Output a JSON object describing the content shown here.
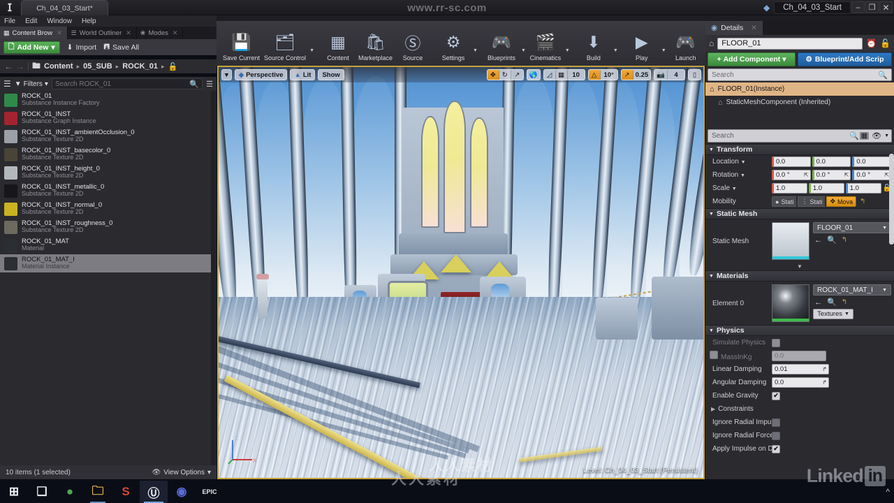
{
  "titlebar": {
    "project_tab": "Ch_04_03_Start*",
    "watermark": "www.rr-sc.com",
    "level_name": "Ch_04_03_Start",
    "minimize": "–",
    "maximize": "❐",
    "close": "✕"
  },
  "menu": {
    "items": [
      "File",
      "Edit",
      "Window",
      "Help"
    ]
  },
  "left_panel": {
    "tabs": [
      {
        "label": "Content Brow",
        "icon": "content-browser-icon",
        "active": true
      },
      {
        "label": "World Outliner",
        "icon": "world-outliner-icon",
        "active": false
      },
      {
        "label": "Modes",
        "icon": "modes-icon",
        "active": false
      }
    ],
    "toolbar": {
      "add_new": "Add New",
      "add_new_caret": "▾",
      "import": "Import",
      "save_all": "Save All"
    },
    "breadcrumb": {
      "back": "←",
      "forward": "→",
      "folder_icon": "folder-icon",
      "items": [
        "Content",
        "05_SUB",
        "ROCK_01"
      ],
      "separator": "▸",
      "lock_icon": "lock-icon"
    },
    "filters": {
      "label": "Filters",
      "caret": "▾",
      "funnel_icon": "funnel-icon"
    },
    "search": {
      "placeholder": "Search ROCK_01",
      "value": ""
    },
    "assets": [
      {
        "name": "ROCK_01",
        "type": "Substance Instance Factory",
        "color": "#2f8a4a",
        "selected": false
      },
      {
        "name": "ROCK_01_INST",
        "type": "Substance Graph Instance",
        "color": "#a32430",
        "selected": false
      },
      {
        "name": "ROCK_01_INST_ambientOcclusion_0",
        "type": "Substance Texture 2D",
        "color": "#9aa0a6",
        "selected": false
      },
      {
        "name": "ROCK_01_INST_basecolor_0",
        "type": "Substance Texture 2D",
        "color": "#4a4438",
        "selected": false
      },
      {
        "name": "ROCK_01_INST_height_0",
        "type": "Substance Texture 2D",
        "color": "#b3b8bd",
        "selected": false
      },
      {
        "name": "ROCK_01_INST_metallic_0",
        "type": "Substance Texture 2D",
        "color": "#17171a",
        "selected": false
      },
      {
        "name": "ROCK_01_INST_normal_0",
        "type": "Substance Texture 2D",
        "color": "#c9b321",
        "selected": false
      },
      {
        "name": "ROCK_01_INST_roughness_0",
        "type": "Substance Texture 2D",
        "color": "#6d6a5e",
        "selected": false
      },
      {
        "name": "ROCK_01_MAT",
        "type": "Material",
        "color": "#2b2e33",
        "selected": false
      },
      {
        "name": "ROCK_01_MAT_I",
        "type": "Material Instance",
        "color": "#2b2e33",
        "selected": true
      }
    ],
    "status": {
      "items_text": "10 items (1 selected)",
      "view_options": "View Options",
      "view_caret": "▾",
      "eye_icon": "eye-icon"
    }
  },
  "main_toolbar": {
    "buttons": [
      {
        "label": "Save Current",
        "icon": "save-icon",
        "caret": false
      },
      {
        "label": "Source Control",
        "icon": "source-control-icon",
        "caret": true
      },
      {
        "label": "Content",
        "icon": "content-icon",
        "caret": false
      },
      {
        "label": "Marketplace",
        "icon": "marketplace-icon",
        "caret": false
      },
      {
        "label": "Source",
        "icon": "substance-source-icon",
        "caret": false
      },
      {
        "label": "Settings",
        "icon": "settings-icon",
        "caret": true
      },
      {
        "label": "Blueprints",
        "icon": "blueprints-icon",
        "caret": true
      },
      {
        "label": "Cinematics",
        "icon": "cinematics-icon",
        "caret": true
      },
      {
        "label": "Build",
        "icon": "build-icon",
        "caret": true
      },
      {
        "label": "Play",
        "icon": "play-icon",
        "caret": true
      },
      {
        "label": "Launch",
        "icon": "launch-icon",
        "caret": false
      }
    ],
    "overflow": "»"
  },
  "viewport": {
    "caret": "▾",
    "perspective": "Perspective",
    "lit": "Lit",
    "show": "Show",
    "transform_tools": [
      "move-gizmo-icon",
      "rotate-gizmo-icon",
      "scale-gizmo-icon"
    ],
    "coord_icon": "world-coords-icon",
    "surface_snap_icon": "surface-snap-icon",
    "grid_snap_icon": "grid-snap-icon",
    "grid_snap_value": "10",
    "rotation_snap_icon": "rotation-snap-icon",
    "rotation_snap_value": "10°",
    "scale_snap_icon": "scale-snap-icon",
    "scale_snap_value": "0.25",
    "camera_speed_icon": "camera-speed-icon",
    "camera_speed_value": "4",
    "maximize_icon": "maximize-viewport-icon",
    "level_status": "Level:  Ch_04_03_Start (Persistent)",
    "watermark": "人人素材",
    "axis_labels": {
      "z": "Z",
      "x": "X",
      "y": "Y"
    }
  },
  "details": {
    "tab_label": "Details",
    "tab_close": "✕",
    "actor_name": "FLOOR_01",
    "lock_icon": "lock-icon",
    "clock_icon": "history-icon",
    "add_component": "Add Component",
    "add_component_caret": "▾",
    "blueprint_script": "Blueprint/Add Scrip",
    "component_search_placeholder": "Search",
    "components": [
      {
        "label": "FLOOR_01(Instance)",
        "selected": true
      },
      {
        "label": "StaticMeshComponent (Inherited)",
        "selected": false
      }
    ],
    "property_search_placeholder": "Search",
    "grid_icon": "grid-view-icon",
    "eye_icon": "eye-icon",
    "eye_caret": "▾",
    "sections": {
      "transform": {
        "title": "Transform",
        "location": {
          "label": "Location",
          "caret": "▾",
          "x": "0.0",
          "y": "0.0",
          "z": "0.0"
        },
        "rotation": {
          "label": "Rotation",
          "caret": "▾",
          "x": "0.0 °",
          "y": "0.0 °",
          "z": "0.0 °"
        },
        "scale": {
          "label": "Scale",
          "caret": "▾",
          "x": "1.0",
          "y": "1.0",
          "z": "1.0",
          "lock_icon": "scale-lock-icon"
        },
        "mobility": {
          "label": "Mobility",
          "options": [
            "Stati",
            "Stati",
            "Mova"
          ],
          "selected_index": 2,
          "reset_icon": "reset-icon"
        }
      },
      "static_mesh": {
        "title": "Static Mesh",
        "row_label": "Static Mesh",
        "asset_name": "FLOOR_01",
        "caret": "▾",
        "icons": [
          "browse-back-icon",
          "search-asset-icon",
          "reset-icon"
        ],
        "thumb_bar_color": "#2ec8d8",
        "expand_icon": "▼"
      },
      "materials": {
        "title": "Materials",
        "row_label": "Element 0",
        "asset_name": "ROCK_01_MAT_I",
        "caret": "▾",
        "icons": [
          "browse-back-icon",
          "search-asset-icon",
          "reset-icon"
        ],
        "textures_button": "Textures",
        "textures_caret": "▾",
        "thumb_bar_color": "#3dbb4a"
      },
      "physics": {
        "title": "Physics",
        "rows": [
          {
            "label": "Simulate Physics",
            "type": "checkbox",
            "checked": false,
            "dim": true
          },
          {
            "label": "MassInKg",
            "type": "checkbox_value",
            "checked": false,
            "value": "0.0",
            "dim": true
          },
          {
            "label": "Linear Damping",
            "type": "number",
            "value": "0.01",
            "dim": false
          },
          {
            "label": "Angular Damping",
            "type": "number",
            "value": "0.0",
            "dim": false
          },
          {
            "label": "Enable Gravity",
            "type": "checkbox",
            "checked": true,
            "dim": false
          },
          {
            "label": "Constraints",
            "type": "expander",
            "dim": false
          },
          {
            "label": "Ignore Radial Impu",
            "type": "checkbox",
            "checked": false,
            "dim": false
          },
          {
            "label": "Ignore Radial Force",
            "type": "checkbox",
            "checked": false,
            "dim": false
          },
          {
            "label": "Apply Impulse on D",
            "type": "checkbox",
            "checked": true,
            "dim": false
          }
        ]
      }
    }
  },
  "taskbar": {
    "items": [
      {
        "name": "windows-start-icon",
        "glyph": "⊞",
        "color": "#e9edf4",
        "state": ""
      },
      {
        "name": "task-view-icon",
        "glyph": "❏",
        "color": "#dfe4ec",
        "state": ""
      },
      {
        "name": "chrome-icon",
        "glyph": "●",
        "color": "#4fa84f",
        "state": ""
      },
      {
        "name": "file-explorer-icon",
        "glyph": "🗀",
        "color": "#f2c14e",
        "state": "open"
      },
      {
        "name": "substance-designer-icon",
        "glyph": "S",
        "color": "#d4483b",
        "state": ""
      },
      {
        "name": "unreal-engine-icon",
        "glyph": "Ⓤ",
        "color": "#e6e9ef",
        "state": "active"
      },
      {
        "name": "epic-launcher-icon",
        "glyph": "◉",
        "color": "#5a6bd8",
        "state": ""
      },
      {
        "name": "epic-games-icon",
        "glyph": "EPIC",
        "color": "#e6e9ef",
        "state": ""
      }
    ],
    "tray_chevron": "^"
  },
  "watermarks": {
    "linkedin": "Linked",
    "linkedin_in": "in",
    "cn_bottom": "人人素材"
  }
}
